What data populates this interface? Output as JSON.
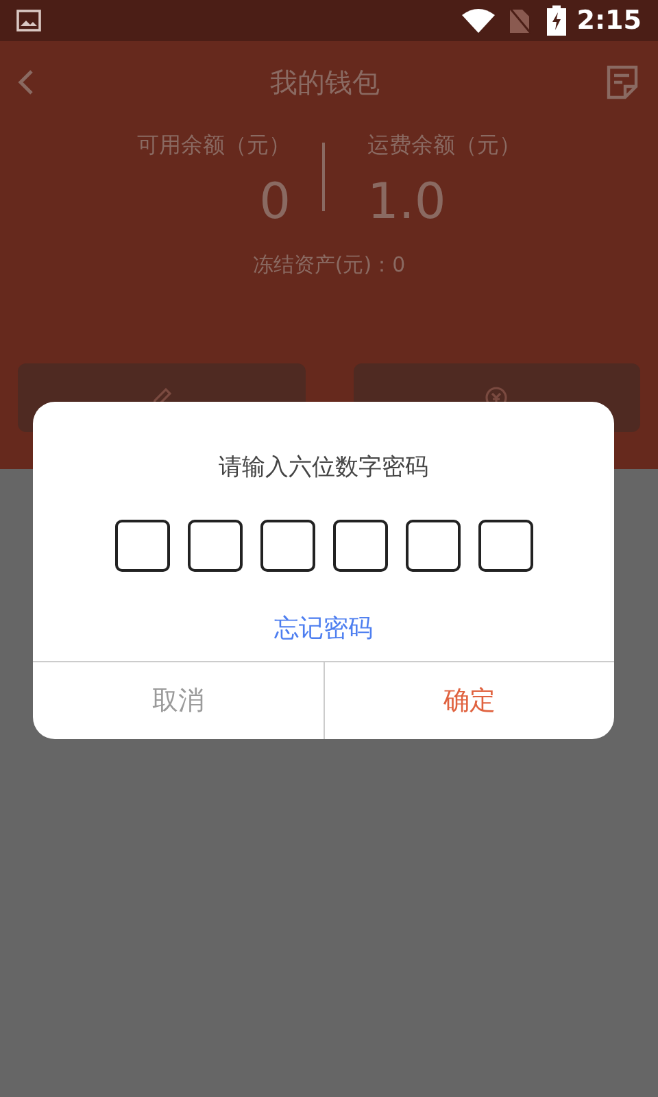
{
  "status_bar": {
    "time": "2:15"
  },
  "header": {
    "title": "我的钱包"
  },
  "balances": [
    {
      "label": "可用余额（元）",
      "value": "0"
    },
    {
      "label": "运费余额（元）",
      "value": "1.0"
    }
  ],
  "frozen": "冻结资产(元)：0",
  "actions": [
    {
      "kind": "withdraw"
    },
    {
      "kind": "recharge"
    }
  ],
  "dialog": {
    "title": "请输入六位数字密码",
    "digits": [
      {
        "filled": false
      },
      {
        "filled": false
      },
      {
        "filled": false
      },
      {
        "filled": false
      },
      {
        "filled": false
      },
      {
        "filled": false
      }
    ],
    "forgot_link": "忘记密码",
    "buttons": [
      {
        "kind": "cancel",
        "label": "取消"
      },
      {
        "kind": "confirm",
        "label": "确定"
      }
    ]
  }
}
